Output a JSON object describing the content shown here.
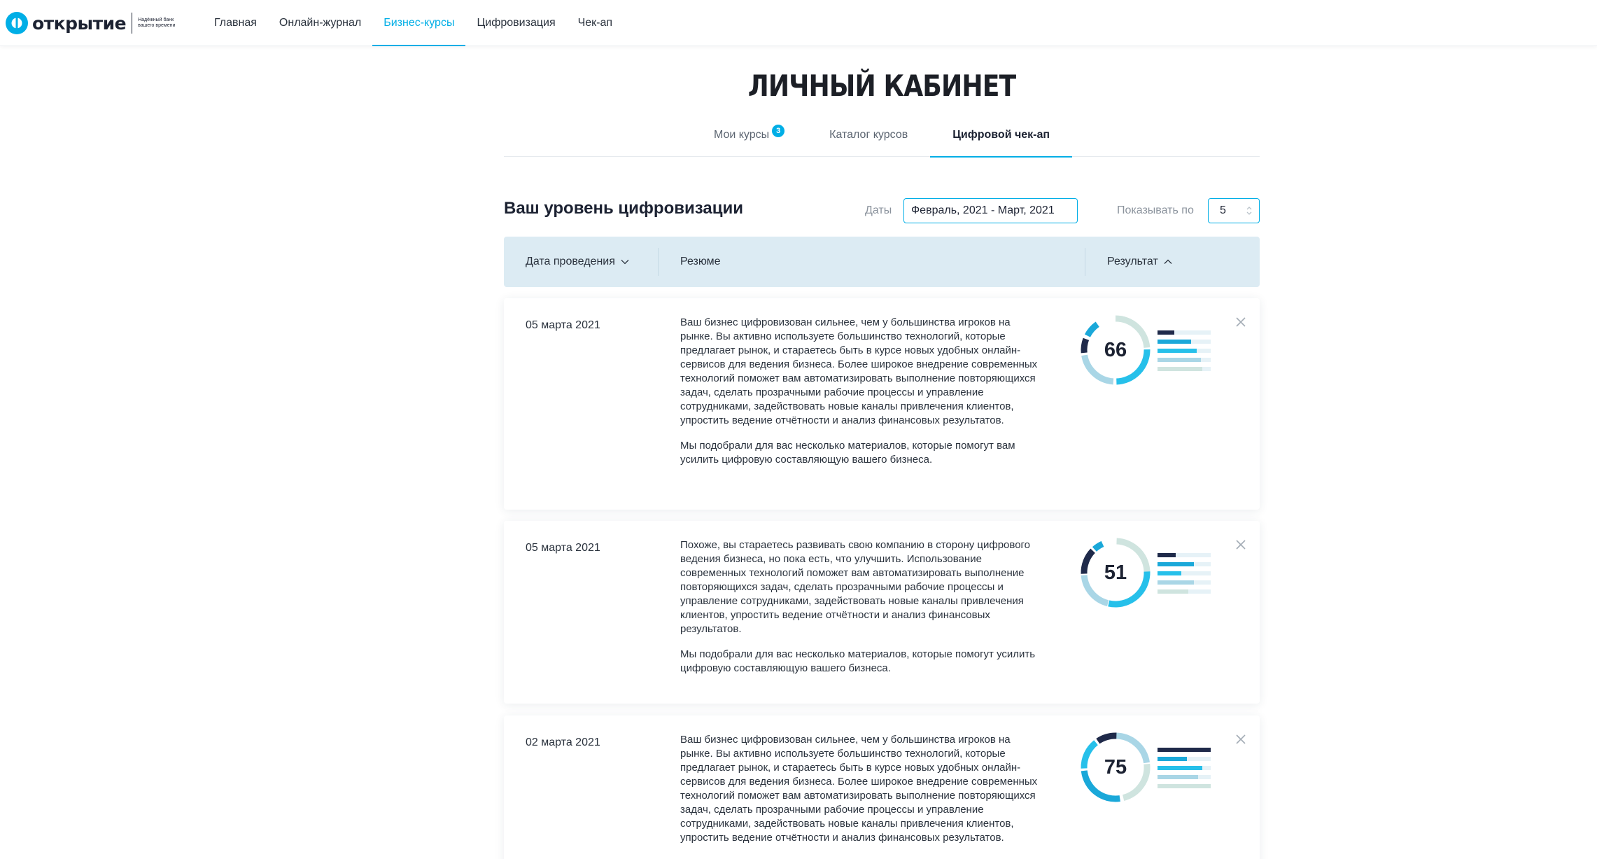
{
  "brand": {
    "name": "открытие",
    "slogan": "Надёжный банк вашего времени"
  },
  "nav": [
    {
      "label": "Главная"
    },
    {
      "label": "Онлайн-журнал"
    },
    {
      "label": "Бизнес-курсы"
    },
    {
      "label": "Цифровизация"
    },
    {
      "label": "Чек-ап"
    }
  ],
  "page": {
    "title": "ЛИЧНЫЙ КАБИНЕТ"
  },
  "tabs": [
    {
      "label": "Мои курсы",
      "badge": "3"
    },
    {
      "label": "Каталог курсов"
    },
    {
      "label": "Цифровой чек-ап"
    }
  ],
  "section": {
    "title": "Ваш уровень цифровизации",
    "dates_label": "Даты",
    "dates_value": "Февраль, 2021 - Март, 2021",
    "per_page_label": "Показывать по",
    "per_page_value": "5"
  },
  "table": {
    "headers": {
      "date": "Дата проведения",
      "summary": "Резюме",
      "result": "Результат"
    },
    "rows": [
      {
        "date": "05 марта 2021",
        "paragraph1": "Ваш бизнес цифровизован сильнее, чем у большинства игроков на рынке. Вы активно используете большинство технологий, которые предлагает рынок, и стараетесь быть в курсе новых удобных онлайн-сервисов для ведения бизнеса. Более широкое внедрение современных технологий поможет вам автоматизировать выполнение повторяющихся задач, сделать прозрачными рабочие процессы и управление сотрудниками, задействовать новые каналы привлечения клиентов, упростить ведение отчётности и анализ финансовых результатов.",
        "paragraph2": "Мы подобрали для вас несколько материалов, которые помогут вам усилить цифровую составляющую вашего бизнеса.",
        "score": "66"
      },
      {
        "date": "05 марта 2021",
        "paragraph1": "Похоже, вы стараетесь развивать свою компанию в сторону цифрового ведения бизнеса, но пока есть, что улучшить. Использование современных технологий поможет вам автоматизировать выполнение повторяющихся задач, сделать прозрачными рабочие процессы и управление сотрудниками, задействовать новые каналы привлечения клиентов, упростить ведение отчётности и анализ финансовых результатов.",
        "paragraph2": "Мы подобрали для вас несколько материалов, которые помогут усилить цифровую составляющую вашего бизнеса.",
        "score": "51"
      },
      {
        "date": "02 марта 2021",
        "paragraph1": "Ваш бизнес цифровизован сильнее, чем у большинства игроков на рынке. Вы активно используете большинство технологий, которые предлагает рынок, и стараетесь быть в курсе новых удобных онлайн-сервисов для ведения бизнеса. Более широкое внедрение современных технологий поможет вам автоматизировать выполнение повторяющихся задач, сделать прозрачными рабочие процессы и управление сотрудниками, задействовать новые каналы привлечения клиентов, упростить ведение отчётности и анализ финансовых результатов.",
        "paragraph2": "",
        "score": "75"
      }
    ]
  },
  "colors": {
    "accent": "#00aee6",
    "navy": "#1c2232",
    "gauge_dark": "#1f2a4a",
    "gauge_blue": "#1aa8d9",
    "gauge_cyan": "#26c0ea",
    "gauge_light": "#a9d6e6",
    "gauge_pale": "#cfe4df",
    "table_head_bg": "#dcebf3"
  },
  "icons": {
    "logo": "otkritie-logo-icon",
    "sort_down": "chevron-down-icon",
    "sort_up": "chevron-up-icon",
    "stepper": "stepper-arrows-icon",
    "close": "close-icon"
  }
}
